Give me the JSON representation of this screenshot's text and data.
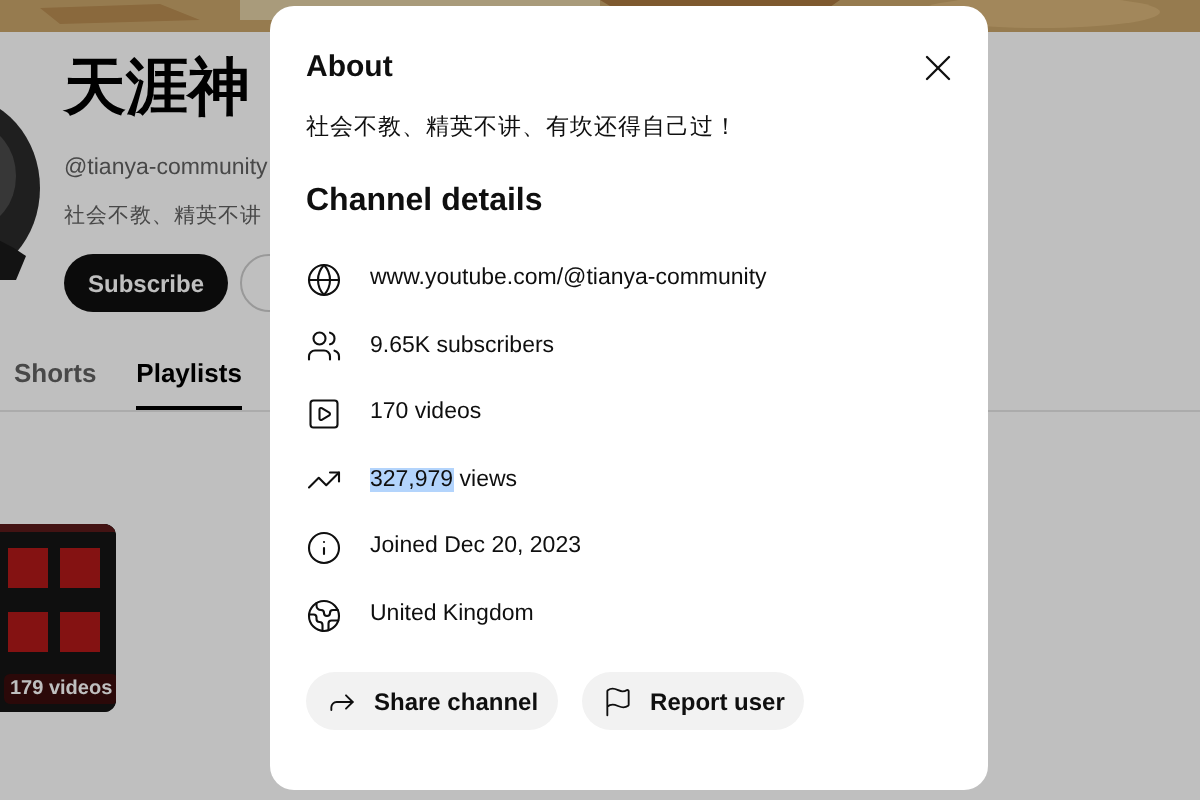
{
  "channel": {
    "name": "天涯神",
    "handle": "@tianya-community",
    "description": "社会不教、精英不讲",
    "buttons": [
      {
        "label": "Subscribe",
        "kind": "primary"
      }
    ]
  },
  "tabs": [
    {
      "label": "Shorts",
      "selected": false
    },
    {
      "label": "Playlists",
      "selected": true
    }
  ],
  "playlist": {
    "count": "179 videos"
  },
  "dialog": {
    "title": "About",
    "description": "社会不教、精英不讲、有坎还得自己过！",
    "details_title": "Channel details",
    "rows": [
      {
        "kind": "link",
        "text": "www.youtube.com/@tianya-community"
      },
      {
        "kind": "subscribers",
        "text": "9.65K subscribers"
      },
      {
        "kind": "videos",
        "text": "170 videos"
      },
      {
        "kind": "views",
        "selected_text": "327,979",
        "text": "views"
      },
      {
        "kind": "joined",
        "text": "Joined Dec 20, 2023"
      },
      {
        "kind": "country",
        "text": "United Kingdom"
      }
    ],
    "actions": [
      {
        "kind": "share",
        "label": "Share channel"
      },
      {
        "kind": "report",
        "label": "Report user"
      }
    ]
  }
}
